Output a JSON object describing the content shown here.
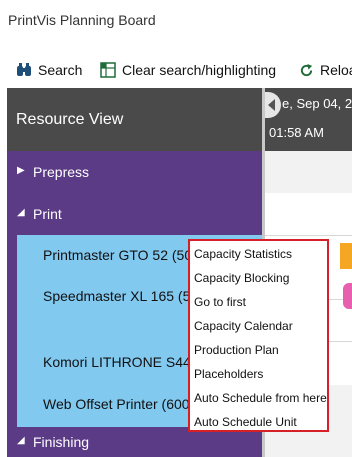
{
  "app": {
    "title": "PrintVis Planning Board"
  },
  "toolbar": {
    "search_label": "Search",
    "clear_label": "Clear search/highlighting",
    "reload_label": "Reloa"
  },
  "resource_panel": {
    "header": "Resource View",
    "groups": [
      {
        "label": "Prepress",
        "expanded": false
      },
      {
        "label": "Print",
        "expanded": true
      },
      {
        "label": "Finishing",
        "expanded": true
      }
    ],
    "print_resources": [
      "Printmaster GTO 52 (50",
      "Speedmaster XL 165 (51",
      "Komori LITHRONE S44 (",
      "Web Offset Printer (600"
    ]
  },
  "timeline": {
    "date": "e, Sep 04, 20",
    "time": "01:58 AM"
  },
  "context_menu": {
    "items": [
      "Capacity Statistics",
      "Capacity Blocking",
      "Go to first",
      "Capacity Calendar",
      "Production Plan",
      "Placeholders",
      "Auto Schedule from here",
      "Auto Schedule Unit"
    ]
  },
  "colors": {
    "header_bg": "#4a4a4a",
    "group_bg": "#5b3a86",
    "resource_bg": "#82c9f0",
    "menu_border": "#d61f26",
    "job_orange": "#f5a623",
    "job_pink": "#e85fb0"
  }
}
